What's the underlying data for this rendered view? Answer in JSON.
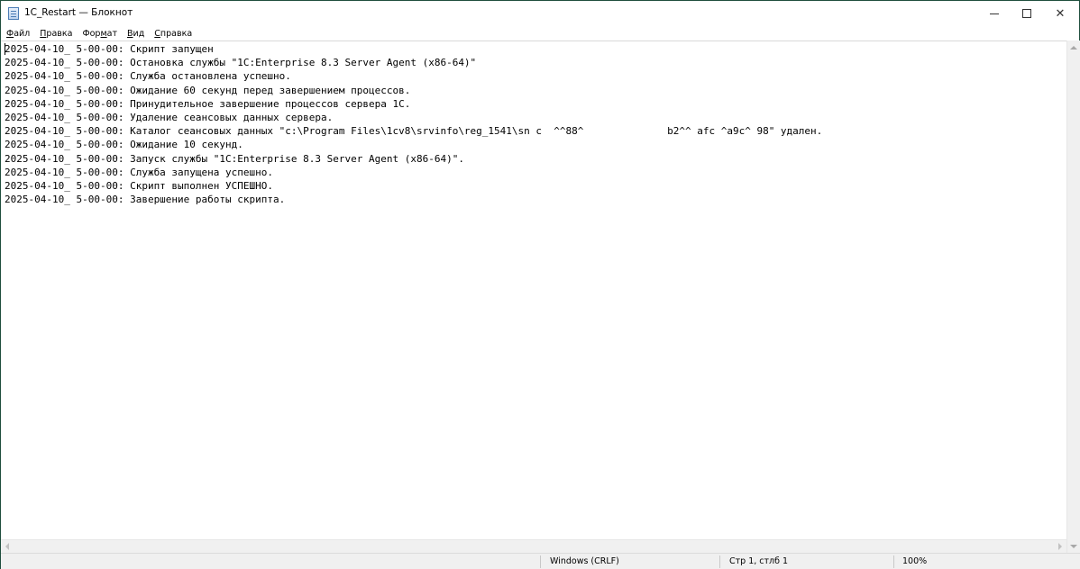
{
  "window": {
    "title": "1C_Restart — Блокнот",
    "minimize": "–",
    "maximize": "□",
    "close": "✕",
    "icon": "notepad-icon"
  },
  "menu": [
    {
      "label_ul": "Ф",
      "label_rest": "айл"
    },
    {
      "label_ul": "П",
      "label_rest": "равка"
    },
    {
      "label_pre": "Фор",
      "label_ul": "м",
      "label_rest": "ат"
    },
    {
      "label_ul": "В",
      "label_rest": "ид"
    },
    {
      "label_ul": "С",
      "label_rest": "правка"
    }
  ],
  "editor": {
    "lines": [
      "2025-04-10_ 5-00-00: Скрипт запущен",
      "2025-04-10_ 5-00-00: Остановка службы \"1C:Enterprise 8.3 Server Agent (x86-64)\"",
      "2025-04-10_ 5-00-00: Служба остановлена успешно.",
      "2025-04-10_ 5-00-00: Ожидание 60 секунд перед завершением процессов.",
      "2025-04-10_ 5-00-00: Принудительное завершение процессов сервера 1C.",
      "2025-04-10_ 5-00-00: Удаление сеансовых данных сервера.",
      "2025-04-10_ 5-00-00: Каталог сеансовых данных \"c:\\Program Files\\1cv8\\srvinfo\\reg_1541\\sn c  ^^88^              b2^^ afc ^a9c^ 98\" удален.",
      "2025-04-10_ 5-00-00: Ожидание 10 секунд.",
      "2025-04-10_ 5-00-00: Запуск службы \"1C:Enterprise 8.3 Server Agent (x86-64)\".",
      "2025-04-10_ 5-00-00: Служба запущена успешно.",
      "2025-04-10_ 5-00-00: Скрипт выполнен УСПЕШНО.",
      "2025-04-10_ 5-00-00: Завершение работы скрипта."
    ]
  },
  "statusbar": {
    "encoding": "Windows (CRLF)",
    "position": "Стр 1, стлб 1",
    "zoom": "100%"
  }
}
